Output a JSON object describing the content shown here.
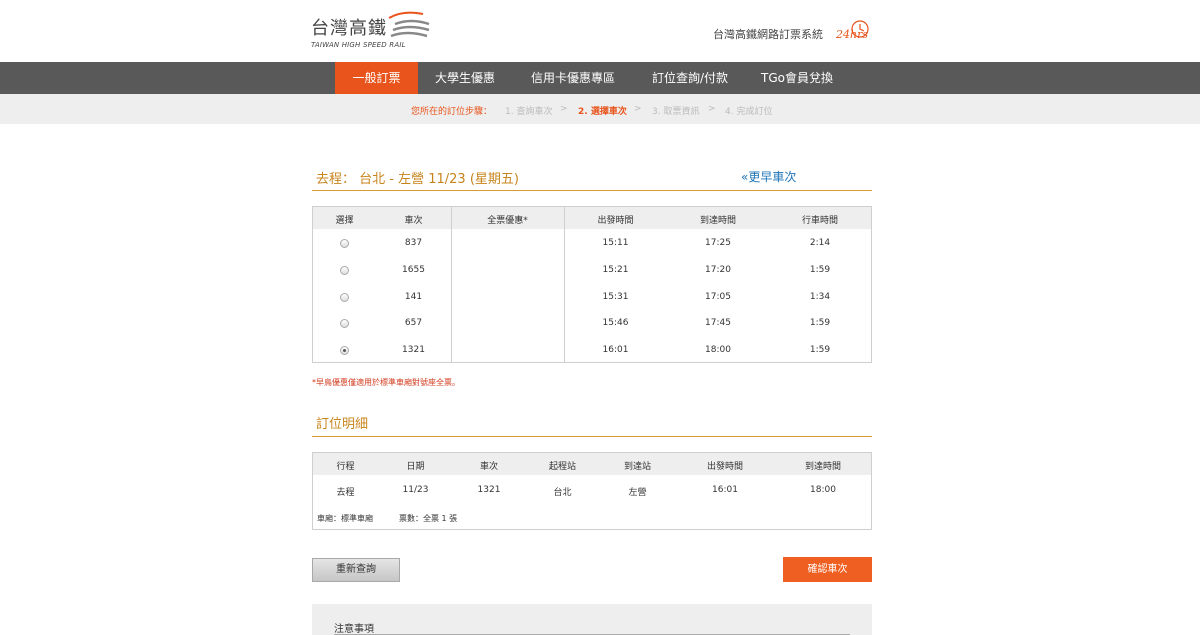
{
  "header": {
    "logo_cn": "台灣高鐵",
    "logo_en": "TAIWAN HIGH SPEED RAIL",
    "system_title": "台灣高鐵網路訂票系統",
    "system_badge": "24hrs"
  },
  "nav": {
    "items": [
      "一般訂票",
      "大學生優惠",
      "信用卡優惠專區",
      "訂位查詢/付款",
      "TGo會員兌換"
    ],
    "active_index": 0
  },
  "steps": {
    "label": "您所在的訂位步驟：",
    "items": [
      "1. 查詢車次",
      "2. 選擇車次",
      "3. 取票資訊",
      "4. 完成訂位"
    ],
    "separator": ">",
    "current_index": 1
  },
  "outbound": {
    "title": "去程：  台北 - 左營 11/23 (星期五)",
    "earlier_link": "«更早車次"
  },
  "trains": {
    "headers": [
      "選擇",
      "車次",
      "全票優惠*",
      "出發時間",
      "到達時間",
      "行車時間"
    ],
    "rows": [
      {
        "train": "837",
        "depart": "15:11",
        "arrive": "17:25",
        "duration": "2:14",
        "selected": false
      },
      {
        "train": "1655",
        "depart": "15:21",
        "arrive": "17:20",
        "duration": "1:59",
        "selected": false
      },
      {
        "train": "141",
        "depart": "15:31",
        "arrive": "17:05",
        "duration": "1:34",
        "selected": false
      },
      {
        "train": "657",
        "depart": "15:46",
        "arrive": "17:45",
        "duration": "1:59",
        "selected": false
      },
      {
        "train": "1321",
        "depart": "16:01",
        "arrive": "18:00",
        "duration": "1:59",
        "selected": true
      }
    ]
  },
  "note": "*早鳥優惠僅適用於標準車廂對號座全票。",
  "detail": {
    "title": "訂位明細",
    "headers": [
      "行程",
      "日期",
      "車次",
      "起程站",
      "到達站",
      "出發時間",
      "到達時間"
    ],
    "row": [
      "去程",
      "11/23",
      "1321",
      "台北",
      "左營",
      "16:01",
      "18:00"
    ],
    "car_type": "車廂：標準車廂",
    "tickets": "票數：全票 1 張"
  },
  "buttons": {
    "requery": "重新查詢",
    "confirm": "確認車次"
  },
  "notice": {
    "title": "注意事項"
  },
  "colors": {
    "accent": "#e8541b",
    "nav_bg": "#595959",
    "section_title": "#c8841c",
    "link": "#1f74b7"
  }
}
